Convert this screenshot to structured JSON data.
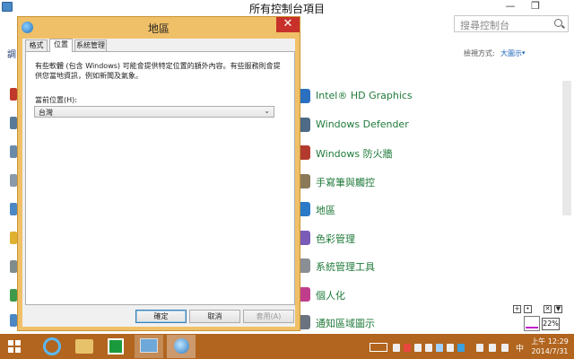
{
  "control_panel": {
    "title": "所有控制台項目",
    "search_placeholder": "搜尋控制台",
    "window_buttons": {
      "minimize": "—",
      "restore": "❐"
    },
    "left_edge_text": "調",
    "view_by_label": "檢視方式:",
    "view_by_value": "大圖示",
    "view_by_caret": "▾",
    "items": [
      {
        "label": "Intel® HD Graphics",
        "icon_color": "#2a6fc0"
      },
      {
        "label": "Windows Defender",
        "icon_color": "#4d6a86"
      },
      {
        "label": "Windows 防火牆",
        "icon_color": "#b33b2e"
      },
      {
        "label": "手寫筆與觸控",
        "icon_color": "#8a7a5a"
      },
      {
        "label": "地區",
        "icon_color": "#2b7ac8"
      },
      {
        "label": "色彩管理",
        "icon_color": "#7a5cb8"
      },
      {
        "label": "系統管理工具",
        "icon_color": "#8a8f96"
      },
      {
        "label": "個人化",
        "icon_color": "#c03d8c"
      },
      {
        "label": "通知區域圖示",
        "icon_color": "#6b7380"
      }
    ],
    "gadget_buttons": [
      "+",
      "•",
      "✕",
      "▼"
    ],
    "gadget_percent": "22%"
  },
  "dialog": {
    "title": "地區",
    "close_glyph": "✕",
    "tabs": [
      {
        "label": "格式",
        "active": false
      },
      {
        "label": "位置",
        "active": true
      },
      {
        "label": "系統管理",
        "active": false
      }
    ],
    "description": "有些軟體 (包含 Windows) 可能會提供特定位置的額外內容。有些服務則會提供您當地資訊，例如新聞及氣象。",
    "location_label": "當前位置(H):",
    "location_value": "台灣",
    "location_caret": "⌄",
    "buttons": {
      "ok": "確定",
      "cancel": "取消",
      "apply": "套用(A)"
    }
  },
  "taskbar": {
    "ime_label": "中",
    "time": "上午 12:29",
    "date": "2014/7/31"
  },
  "colors": {
    "dialog_frame": "#f0c068",
    "taskbar": "#b1651f",
    "close_button": "#c8312a",
    "cp_link_green": "#1f7a3a"
  }
}
